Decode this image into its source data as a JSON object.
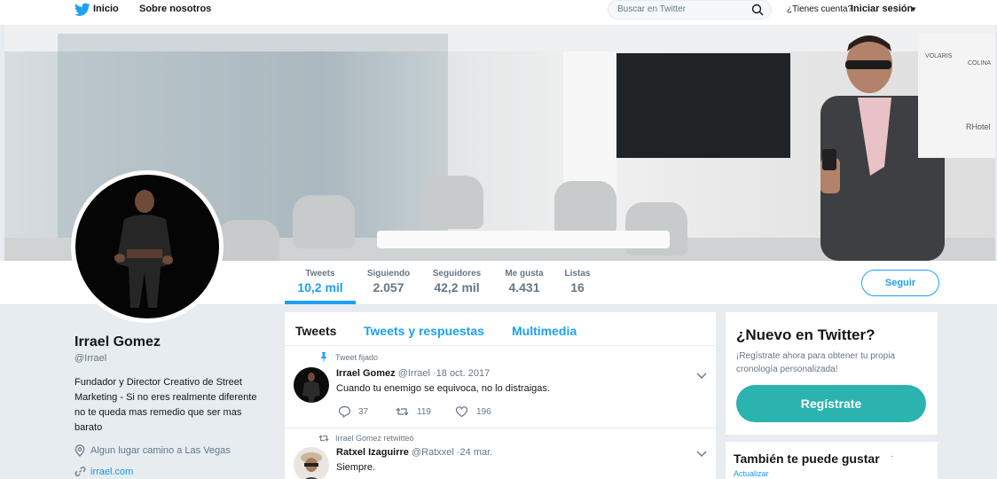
{
  "nav": {
    "home": "Inicio",
    "about": "Sobre nosotros",
    "search_placeholder": "Buscar en Twitter",
    "account_question": "¿Tienes cuenta?",
    "login": "Iniciar sesión",
    "login_caret": "▼"
  },
  "banner": {
    "logos": [
      "COLINA",
      "VOLARIS",
      "RHotel"
    ]
  },
  "stats": [
    {
      "label": "Tweets",
      "value": "10,2 mil"
    },
    {
      "label": "Siguiendo",
      "value": "2.057"
    },
    {
      "label": "Seguidores",
      "value": "42,2 mil"
    },
    {
      "label": "Me gusta",
      "value": "4.431"
    },
    {
      "label": "Listas",
      "value": "16"
    }
  ],
  "follow_label": "Seguir",
  "profile": {
    "name": "Irrael Gomez",
    "handle": "@Irrael",
    "bio": "Fundador y Director Creativo de Street Marketing - Si no eres realmente diferente no te queda mas remedio que ser mas barato",
    "location": "Algun lugar camino a Las Vegas",
    "url": "irrael.com"
  },
  "tabs": [
    "Tweets",
    "Tweets y respuestas",
    "Multimedia"
  ],
  "tweets": [
    {
      "context": "Tweet fijado",
      "name": "Irrael Gomez",
      "meta": "@Irrael ·18 oct. 2017",
      "text": "Cuando tu enemigo se equivoca, no lo distraigas.",
      "replies": "37",
      "retweets": "119",
      "likes": "196"
    },
    {
      "context": "Irrael Gomez retwitteó",
      "name": "Ratxel Izaguirre",
      "meta": "@Ratxxel ·24 mar.",
      "text": "Siempre."
    }
  ],
  "signup": {
    "title": "¿Nuevo en Twitter?",
    "subtitle": "¡Regístrate ahora para obtener tu propia cronología personalizada!",
    "button": "Regístrate"
  },
  "who_to_follow": {
    "title": "También te puede gustar",
    "dot": "·",
    "update": "Actualizar"
  },
  "colors": {
    "accent": "#1da1f2",
    "signup_button": "#2ab3af"
  }
}
